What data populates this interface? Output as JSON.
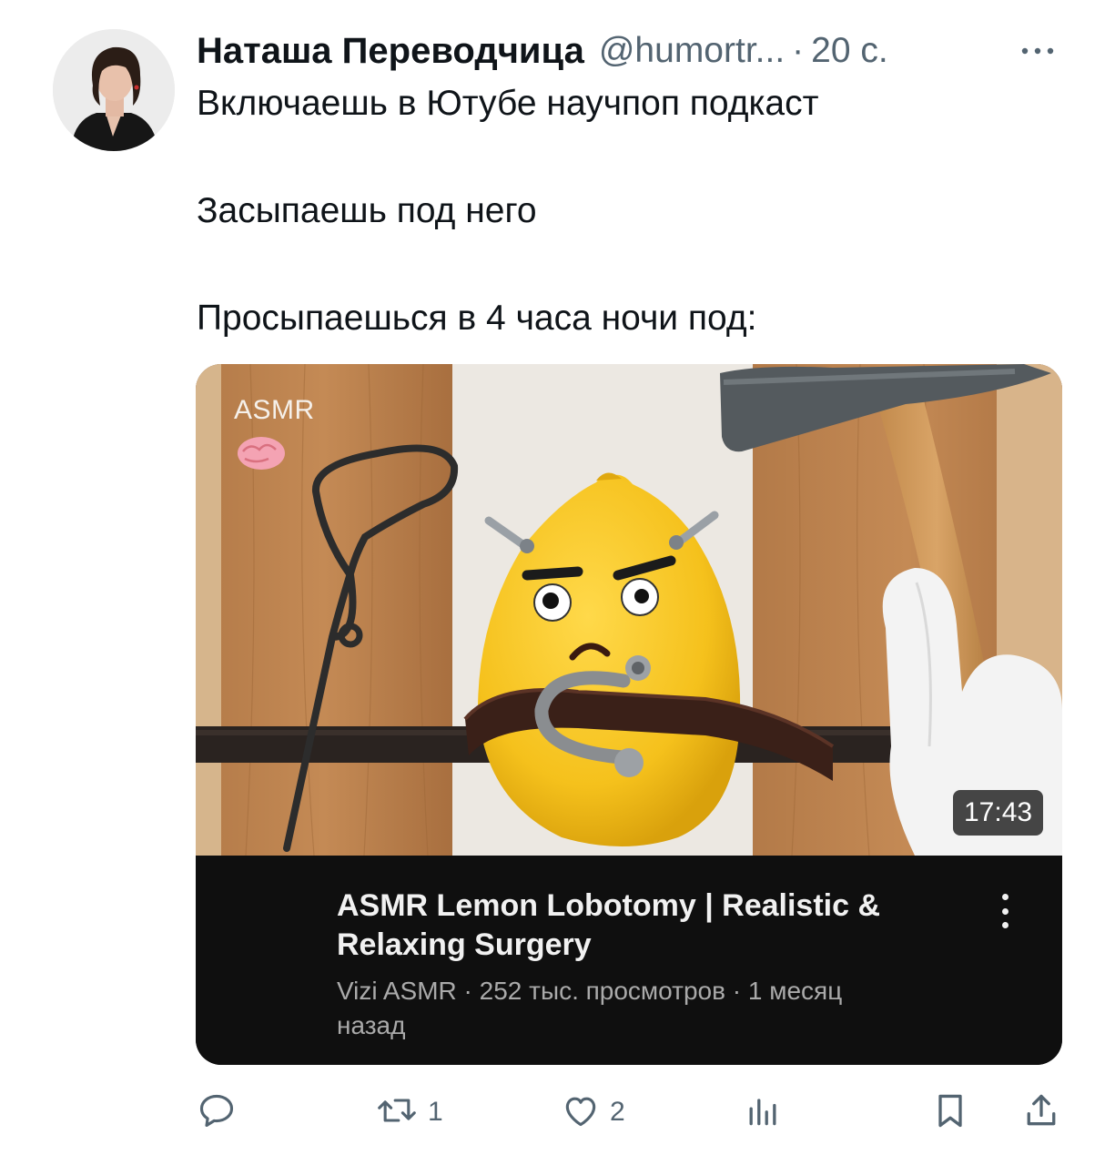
{
  "tweet": {
    "author_name": "Наташа Переводчица",
    "author_handle": "@humortr...",
    "separator": "·",
    "time": "20 с.",
    "lines": [
      "Включаешь в Ютубе научпоп подкаст",
      "Засыпаешь под него",
      "Просыпаешься в 4 часа ночи под:"
    ]
  },
  "video": {
    "thumbnail_label": "ASMR",
    "duration": "17:43",
    "title_lines": [
      "ASMR Lemon Lobotomy | Realistic &",
      "Relaxing Surgery"
    ],
    "meta_lines": [
      "Vizi ASMR · 252 тыс. просмотров · 1 месяц",
      "назад"
    ]
  },
  "actions": {
    "reply_count": "",
    "retweet_count": "1",
    "like_count": "2",
    "views_count": ""
  },
  "icons": [
    "more-icon",
    "brain-icon",
    "reply-icon",
    "retweet-icon",
    "like-icon",
    "views-icon",
    "bookmark-icon",
    "share-icon"
  ],
  "colors": {
    "text": "#0f1419",
    "secondary": "#536471",
    "video_panel": "#0f0f0f",
    "video_title": "#f1f1f1",
    "video_meta": "#aaaaaa",
    "lemon": "#f7c520"
  }
}
